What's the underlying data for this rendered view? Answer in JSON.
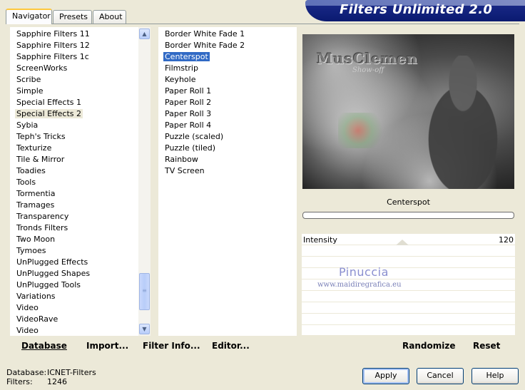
{
  "tabs": [
    {
      "label": "Navigator"
    },
    {
      "label": "Presets"
    },
    {
      "label": "About"
    }
  ],
  "banner": {
    "title": "Filters Unlimited 2.0"
  },
  "categories": {
    "items": [
      "Sapphire Filters 11",
      "Sapphire Filters 12",
      "Sapphire Filters 1c",
      "ScreenWorks",
      "Scribe",
      "Simple",
      "Special Effects 1",
      "Special Effects 2",
      "Sybia",
      "Teph's Tricks",
      "Texturize",
      "Tile & Mirror",
      "Toadies",
      "Tools",
      "Tormentia",
      "Tramages",
      "Transparency",
      "Tronds Filters",
      "Two Moon",
      "Tymoes",
      "UnPlugged Effects",
      "UnPlugged Shapes",
      "UnPlugged Tools",
      "Variations",
      "Video",
      "VideoRave",
      "Video"
    ],
    "selected": "Special Effects 2"
  },
  "filters": {
    "items": [
      "Border White Fade 1",
      "Border White Fade 2",
      "Centerspot",
      "Filmstrip",
      "Keyhole",
      "Paper Roll 1",
      "Paper Roll 2",
      "Paper Roll 3",
      "Paper Roll 4",
      "Puzzle (scaled)",
      "Puzzle (tiled)",
      "Rainbow",
      "TV Screen"
    ],
    "selected": "Centerspot"
  },
  "left_toolbar": {
    "database": "Database",
    "import": "Import...",
    "filter_info": "Filter Info...",
    "editor": "Editor..."
  },
  "right_toolbar": {
    "randomize": "Randomize",
    "reset": "Reset"
  },
  "preview": {
    "logo_text": "MusClemen",
    "logo_sub": "Show-off"
  },
  "filter_name": "Centerspot",
  "progress": 0,
  "params": [
    {
      "label": "Intensity",
      "value": "120"
    }
  ],
  "watermark": {
    "name": "Pinuccia",
    "url": "www.maidiregrafica.eu"
  },
  "status": {
    "database_label": "Database:",
    "database_value": "ICNET-Filters",
    "filters_label": "Filters:",
    "filters_value": "1246"
  },
  "buttons": {
    "apply": "Apply",
    "cancel": "Cancel",
    "help": "Help"
  },
  "colors": {
    "window_bg": "#ECE9D8",
    "selection_blue": "#316AC5",
    "banner_blue": "#0A1A70"
  }
}
